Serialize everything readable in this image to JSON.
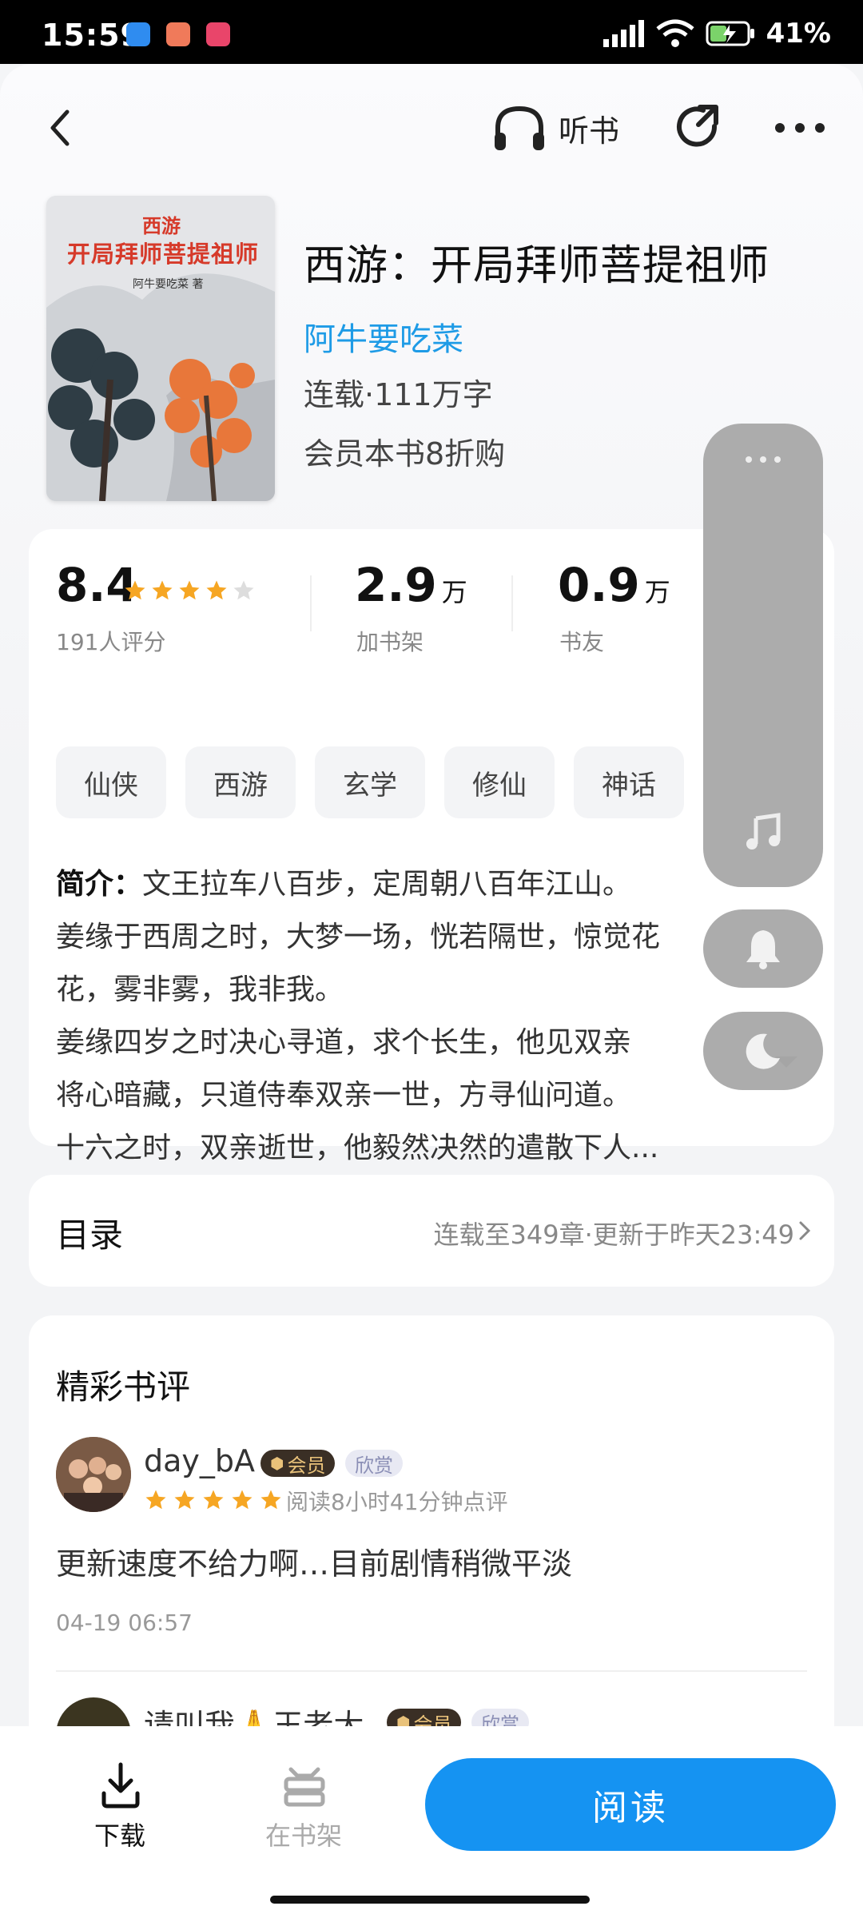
{
  "status": {
    "time": "15:59",
    "battery": "41%"
  },
  "header": {
    "listen_label": "听书"
  },
  "book": {
    "title": "西游：开局拜师菩提祖师",
    "author": "阿牛要吃菜",
    "meta": "连载·111万字",
    "promo": "会员本书8折购",
    "cover_title_top": "西游",
    "cover_title_main": "开局拜师菩提祖师",
    "cover_author": "阿牛要吃菜 著"
  },
  "stats": {
    "rating": "8.4",
    "rating_label": "191人评分",
    "rating_stars": 4.5,
    "shelf_num": "2.9",
    "shelf_unit": "万",
    "shelf_label": "加书架",
    "fans_num": "0.9",
    "fans_unit": "万",
    "fans_label": "书友"
  },
  "tags": [
    "仙侠",
    "西游",
    "玄学",
    "修仙",
    "神话"
  ],
  "intro": {
    "label": "简介：",
    "lines": [
      "文王拉车八百步，定周朝八百年江山。",
      "姜缘于西周之时，大梦一场，恍若隔世，惊觉花",
      "花，雾非雾，我非我。",
      "姜缘四岁之时决心寻道，求个长生，他见双亲",
      "将心暗藏，只道侍奉双亲一世，方寻仙问道。",
      "十六之时，双亲逝世，他毅然决然的遣散下人..."
    ]
  },
  "toc": {
    "title": "目录",
    "info": "连载至349章·更新于昨天23:49"
  },
  "reviews": {
    "heading": "精彩书评",
    "items": [
      {
        "user": "day_bA",
        "vip_label": "会员",
        "like_label": "欣赏",
        "read_time": "阅读8小时41分钟点评",
        "content": "更新速度不给力啊…目前剧情稍微平淡",
        "date": "04-19 06:57"
      },
      {
        "user": "请叫我🙏王老大",
        "vip_label": "会员",
        "like_label": "欣赏"
      }
    ]
  },
  "bottom": {
    "download_label": "下载",
    "shelf_label": "在书架",
    "read_label": "阅读"
  },
  "colors": {
    "accent": "#1593f2",
    "author": "#1e9be6",
    "star": "#f6a623"
  }
}
